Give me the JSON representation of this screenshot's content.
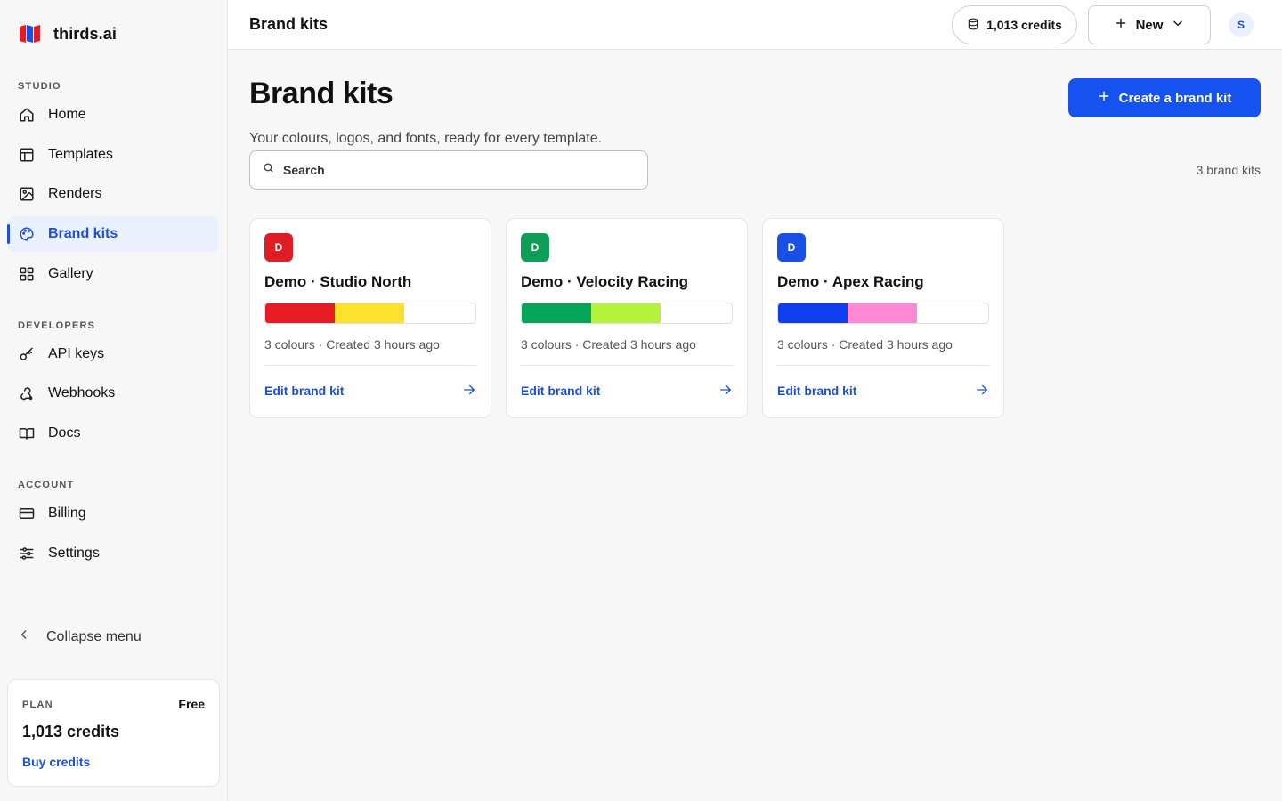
{
  "app": {
    "name": "thirds.ai"
  },
  "sidebar": {
    "sections": [
      {
        "label": "STUDIO"
      },
      {
        "label": "DEVELOPERS"
      },
      {
        "label": "ACCOUNT"
      }
    ],
    "items": [
      {
        "label": "Home",
        "icon": "home-icon"
      },
      {
        "label": "Templates",
        "icon": "layout-icon"
      },
      {
        "label": "Renders",
        "icon": "image-icon"
      },
      {
        "label": "Brand kits",
        "icon": "palette-icon",
        "active": true
      },
      {
        "label": "Gallery",
        "icon": "grid-icon"
      },
      {
        "label": "API keys",
        "icon": "key-icon"
      },
      {
        "label": "Webhooks",
        "icon": "webhook-icon"
      },
      {
        "label": "Docs",
        "icon": "book-icon"
      },
      {
        "label": "Billing",
        "icon": "credit-card-icon"
      },
      {
        "label": "Settings",
        "icon": "sliders-icon"
      }
    ],
    "collapse_label": "Collapse menu",
    "plan": {
      "label": "PLAN",
      "tier": "Free",
      "credits": "1,013 credits",
      "buy_label": "Buy credits"
    }
  },
  "topbar": {
    "title": "Brand kits",
    "credits": "1,013 credits",
    "new_label": "New",
    "avatar_initial": "S"
  },
  "main": {
    "title": "Brand kits",
    "create_label": "Create a brand kit",
    "subtitle": "Your colours, logos, and fonts, ready for every template.",
    "search_placeholder": "Search",
    "count_label": "3 brand kits",
    "kits": [
      {
        "initial": "D",
        "badge_color": "#e11d24",
        "title": "Demo · Studio North",
        "colors": [
          "#e81a24",
          "#fde12d"
        ],
        "meta": "3 colours · Created 3 hours ago",
        "link": "Edit brand kit"
      },
      {
        "initial": "D",
        "badge_color": "#0f9d58",
        "title": "Demo · Velocity Racing",
        "colors": [
          "#03a55a",
          "#b4f23c"
        ],
        "meta": "3 colours · Created 3 hours ago",
        "link": "Edit brand kit"
      },
      {
        "initial": "D",
        "badge_color": "#1a4fe6",
        "title": "Demo · Apex Racing",
        "colors": [
          "#0f3ef0",
          "#ff88d4"
        ],
        "meta": "3 colours · Created 3 hours ago",
        "link": "Edit brand kit"
      }
    ]
  },
  "colors": {
    "accent": "#1652f0",
    "active_bg": "#eaf0fc"
  }
}
